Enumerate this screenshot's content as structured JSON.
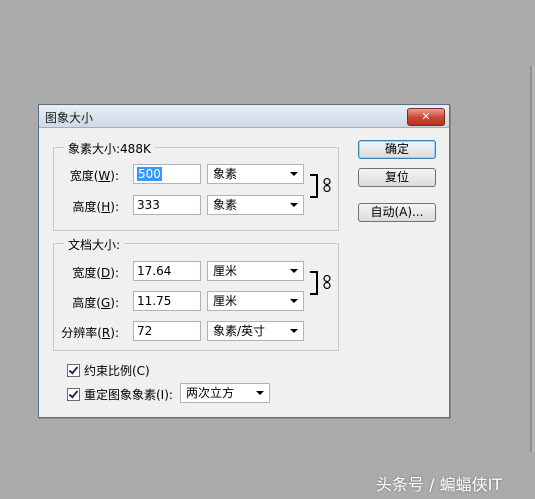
{
  "dialog": {
    "title": "图象大小",
    "close_glyph": "✕"
  },
  "pixel_dimensions": {
    "legend": "象素大小:488K",
    "width": {
      "label_main": "宽度(",
      "label_key": "W",
      "label_end": "):",
      "value": "500",
      "unit": "象素"
    },
    "height": {
      "label_main": "高度(",
      "label_key": "H",
      "label_end": "):",
      "value": "333",
      "unit": "象素"
    }
  },
  "document_size": {
    "legend": "文档大小:",
    "width": {
      "label_main": "宽度(",
      "label_key": "D",
      "label_end": "):",
      "value": "17.64",
      "unit": "厘米"
    },
    "height": {
      "label_main": "高度(",
      "label_key": "G",
      "label_end": "):",
      "value": "11.75",
      "unit": "厘米"
    },
    "resolution": {
      "label_main": "分辨率(",
      "label_key": "R",
      "label_end": "):",
      "value": "72",
      "unit": "象素/英寸"
    }
  },
  "buttons": {
    "ok": "确定",
    "reset": "复位",
    "auto": "自动(A)..."
  },
  "options": {
    "constrain": {
      "label": "约束比例(C)",
      "checked": true
    },
    "resample": {
      "label": "重定图象象素(I):",
      "checked": true,
      "method": "两次立方"
    }
  },
  "watermark": "头条号 / 蝙蝠侠IT",
  "icons": {
    "chain": "link-chain-icon",
    "dropdown": "chevron-down-icon"
  }
}
